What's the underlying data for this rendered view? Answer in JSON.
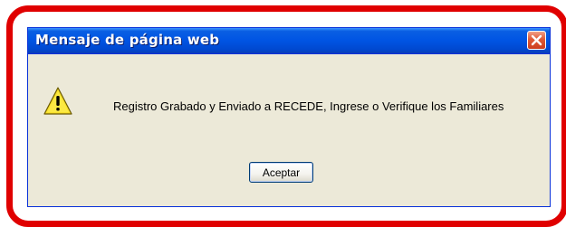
{
  "dialog": {
    "title": "Mensaje de página web",
    "close_icon": "close-icon",
    "warning_icon": "warning-icon",
    "message": "Registro Grabado y Enviado a RECEDE, Ingrese o Verifique los Familiares",
    "ok_label": "Aceptar"
  },
  "colors": {
    "highlight_frame": "#e00000",
    "titlebar": "#0054e3",
    "dialog_bg": "#ece9d8"
  }
}
